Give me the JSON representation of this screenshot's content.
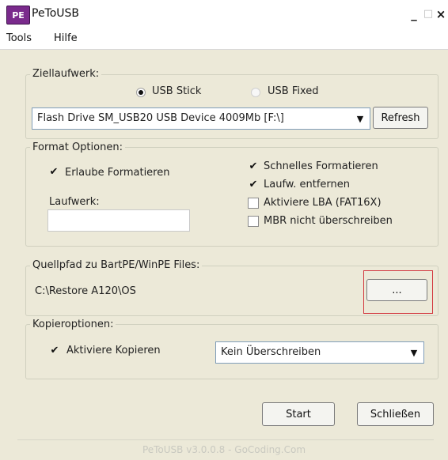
{
  "window": {
    "title": "PeToUSB",
    "logo_text": "PE",
    "controls": {
      "minimize": "_",
      "maximize": "□",
      "close": "×"
    }
  },
  "menu": {
    "items": [
      "Tools",
      "Hilfe"
    ]
  },
  "ziel": {
    "title": "Ziellaufwerk:",
    "radio_usb_stick": "USB Stick",
    "radio_usb_fixed": "USB Fixed",
    "selected": "USB Stick",
    "drive_value": "Flash Drive SM_USB20 USB Device 4009Mb [F:\\]",
    "refresh_label": "Refresh"
  },
  "format": {
    "title": "Format Optionen:",
    "erlaube_label": "Erlaube Formatieren",
    "erlaube_checked": true,
    "laufwerk_label": "Laufwerk:",
    "laufwerk_value": "",
    "schnelles_label": "Schnelles Formatieren",
    "schnelles_checked": true,
    "entfernen_label": "Laufw. entfernen",
    "entfernen_checked": true,
    "lba_label": "Aktiviere LBA (FAT16X)",
    "lba_checked": false,
    "mbr_label": "MBR nicht überschreiben",
    "mbr_checked": false
  },
  "quelle": {
    "title": "Quellpfad zu BartPE/WinPE Files:",
    "path": "C:\\Restore A120\\OS",
    "browse_label": "..."
  },
  "kopie": {
    "title": "Kopieroptionen:",
    "aktiviere_label": "Aktiviere Kopieren",
    "aktiviere_checked": true,
    "mode_value": "Kein Überschreiben"
  },
  "actions": {
    "start_label": "Start",
    "close_label": "Schließen"
  },
  "footer": {
    "version": "PeToUSB v3.0.0.8 - GoCoding.Com"
  },
  "colors": {
    "highlight": "#d2373f",
    "window_bg": "#ece9d8"
  },
  "icons": {
    "check": "✔",
    "dropdown": "▼"
  }
}
